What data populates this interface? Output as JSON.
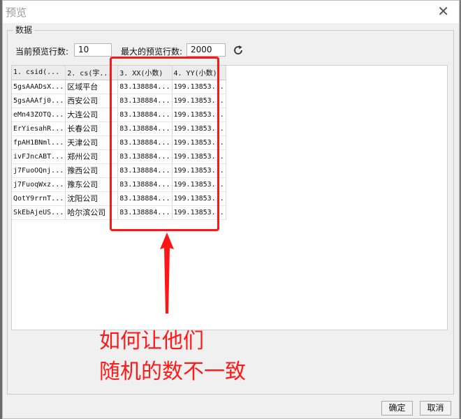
{
  "dialog": {
    "title": "预览",
    "close_glyph": "✕",
    "group_label": "数据",
    "current_rows_label": "当前预览行数:",
    "current_rows_value": "10",
    "max_rows_label": "最大的预览行数:",
    "max_rows_value": "2000",
    "ok_label": "确定",
    "cancel_label": "取消"
  },
  "table": {
    "columns": [
      "1. csid(...",
      "2. cs(字...",
      "3. XX(小数)",
      "4. YY(小数)"
    ],
    "rows": [
      [
        "5gsAAADsX...",
        "区域平台",
        "83.138884...",
        "199.13853..."
      ],
      [
        "5gsAAAfj0...",
        "西安公司",
        "83.138884...",
        "199.13853..."
      ],
      [
        "eMn43ZOTQ...",
        "大连公司",
        "83.138884...",
        "199.13853..."
      ],
      [
        "ErYiesahR...",
        "长春公司",
        "83.138884...",
        "199.13853..."
      ],
      [
        "fpAH1BNml...",
        "天津公司",
        "83.138884...",
        "199.13853..."
      ],
      [
        "ivFJncABT...",
        "郑州公司",
        "83.138884...",
        "199.13853..."
      ],
      [
        "j7FuoOQnj...",
        "豫西公司",
        "83.138884...",
        "199.13853..."
      ],
      [
        "j7FuoqWxz...",
        "豫东公司",
        "83.138884...",
        "199.13853..."
      ],
      [
        "QotY9rrnT...",
        "沈阳公司",
        "83.138884...",
        "199.13853..."
      ],
      [
        "SkEbAjeUS...",
        "哈尔滨公司",
        "83.138884...",
        "199.13853..."
      ]
    ]
  },
  "annotation": {
    "line1": "如何让他们",
    "line2": "随机的数不一致",
    "color": "#ff1a1a"
  },
  "icons": {
    "refresh": "refresh-icon",
    "close": "close-icon"
  }
}
